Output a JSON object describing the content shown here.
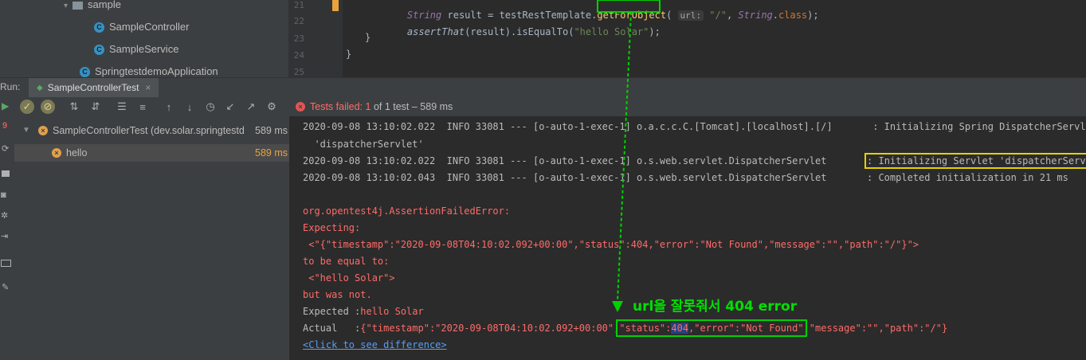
{
  "project_tree": {
    "folder": "sample",
    "items": [
      "SampleController",
      "SampleService",
      "SpringtestdemoApplication"
    ]
  },
  "editor": {
    "line_numbers": [
      "21",
      "22",
      "23",
      "24",
      "25"
    ],
    "line21": {
      "type": "String",
      "var": "result",
      "eq": "=",
      "obj": "testRestTemplate",
      "method": "getForObject",
      "hint": "url:",
      "str": "\"/\"",
      "type2": "String",
      "cls": "class",
      "end": ");"
    },
    "line22": {
      "fn": "assertThat",
      "arg": "(result).",
      "method": "isEqualTo",
      "str": "\"hello Solar\"",
      "end": ");"
    },
    "line23": "}",
    "line24": "}"
  },
  "run": {
    "label": "Run:",
    "tab_title": "SampleControllerTest",
    "status": {
      "prefix": "Tests failed:",
      "failed": "1",
      "suffix": "of 1 test – 589 ms"
    }
  },
  "test_tree": [
    {
      "label": "SampleControllerTest (dev.solar.springtestd",
      "time": "589 ms"
    },
    {
      "label": "hello",
      "time": "589 ms"
    }
  ],
  "console": {
    "log1": "2020-09-08 13:10:02.022  INFO 33081 --- [o-auto-1-exec-1] o.a.c.c.C.[Tomcat].[localhost].[/]       : Initializing Spring DispatcherServlet",
    "log1b": "  'dispatcherServlet'",
    "log2a": "2020-09-08 13:10:02.022  INFO 33081 --- [o-auto-1-exec-1] o.s.web.servlet.DispatcherServlet       ",
    "log2b": ": Initializing Servlet 'dispatcherServlet",
    "log3": "2020-09-08 13:10:02.043  INFO 33081 --- [o-auto-1-exec-1] o.s.web.servlet.DispatcherServlet       : Completed initialization in 21 ms",
    "err_class": "org.opentest4j.AssertionFailedError:",
    "expecting": "Expecting:",
    "expecting_val": " <\"{\"timestamp\":\"2020-09-08T04:10:02.092+00:00\",\"status\":404,\"error\":\"Not Found\",\"message\":\"\",\"path\":\"/\"}\">",
    "to_be": "to be equal to:",
    "to_be_val": " <\"hello Solar\">",
    "but": "but was not.",
    "expected_label": "Expected :",
    "expected_val": "hello Solar",
    "actual_label": "Actual   :",
    "actual_val_a": "{\"timestamp\":\"2020-09-08T04:10:02.092+00:00\",",
    "actual_val_b": "\"status\":",
    "actual_val_404": "404",
    "actual_val_c": ",\"error\":\"Not Found\"",
    "actual_val_d": ",\"message\":\"\",\"path\":\"/\"}",
    "diff_link": "<Click to see difference>"
  },
  "annotation": {
    "text": "url을 잘못줘서 404 error",
    "color": "#00e000"
  },
  "highlight_colors": {
    "yellow_box": "#e6d200",
    "green_box": "#00d000"
  }
}
